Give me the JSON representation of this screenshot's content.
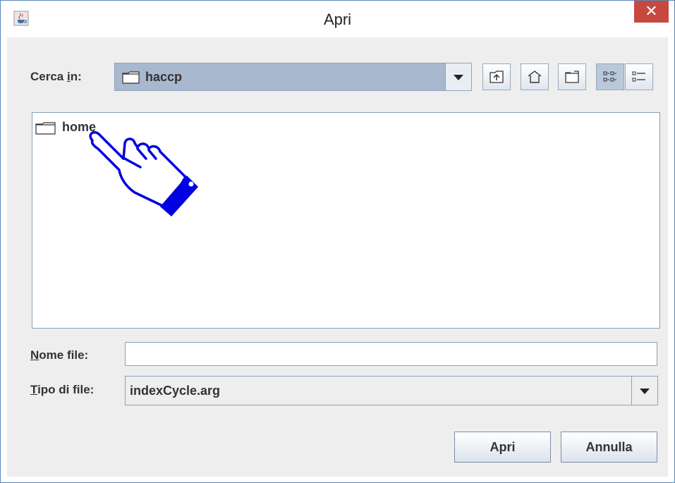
{
  "window": {
    "title": "Apri",
    "close_glyph": "✕",
    "app_icon": "java-cup-icon"
  },
  "look_in": {
    "label_pre": "Cerca ",
    "label_mnemonic": "i",
    "label_post": "n:",
    "value": "haccp",
    "icon": "folder-icon"
  },
  "toolbar": {
    "buttons": [
      {
        "name": "up-one-level-button",
        "icon": "folder-up-icon"
      },
      {
        "name": "home-button",
        "icon": "home-icon"
      },
      {
        "name": "new-folder-button",
        "icon": "new-folder-icon"
      },
      {
        "name": "list-view-button",
        "icon": "list-view-icon",
        "selected": true
      },
      {
        "name": "details-view-button",
        "icon": "details-view-icon"
      }
    ]
  },
  "files": [
    {
      "name": "home",
      "icon": "folder-icon"
    }
  ],
  "cursor": {
    "icon": "pointing-hand-cursor-icon"
  },
  "file_name": {
    "label_mnemonic": "N",
    "label_rest": "ome file:",
    "value": ""
  },
  "file_type": {
    "label_mnemonic": "T",
    "label_rest": "ipo di file:",
    "value": "indexCycle.arg"
  },
  "buttons": {
    "open": "Apri",
    "cancel": "Annulla"
  },
  "colors": {
    "close_button": "#c7483f",
    "combo_selected": "#a8b8ce",
    "cursor_blue": "#0000e0"
  }
}
